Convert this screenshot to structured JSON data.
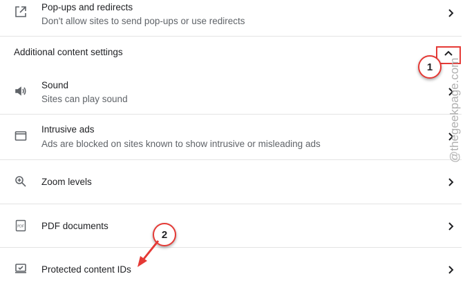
{
  "rows": [
    {
      "title": "Pop-ups and redirects",
      "subtitle": "Don't allow sites to send pop-ups or use redirects",
      "icon": "open-external-icon"
    },
    {
      "title": "Sound",
      "subtitle": "Sites can play sound",
      "icon": "speaker-icon"
    },
    {
      "title": "Intrusive ads",
      "subtitle": "Ads are blocked on sites known to show intrusive or misleading ads",
      "icon": "browser-window-icon"
    },
    {
      "title": "Zoom levels",
      "icon": "zoom-in-icon"
    },
    {
      "title": "PDF documents",
      "icon": "pdf-file-icon"
    },
    {
      "title": "Protected content IDs",
      "icon": "protected-content-icon"
    }
  ],
  "section": {
    "title": "Additional content settings",
    "icon": "chevron-up-icon"
  },
  "annotations": {
    "step1": "1",
    "step2": "2",
    "accent": "#e53935"
  },
  "watermark": "@thegeekpage.com"
}
